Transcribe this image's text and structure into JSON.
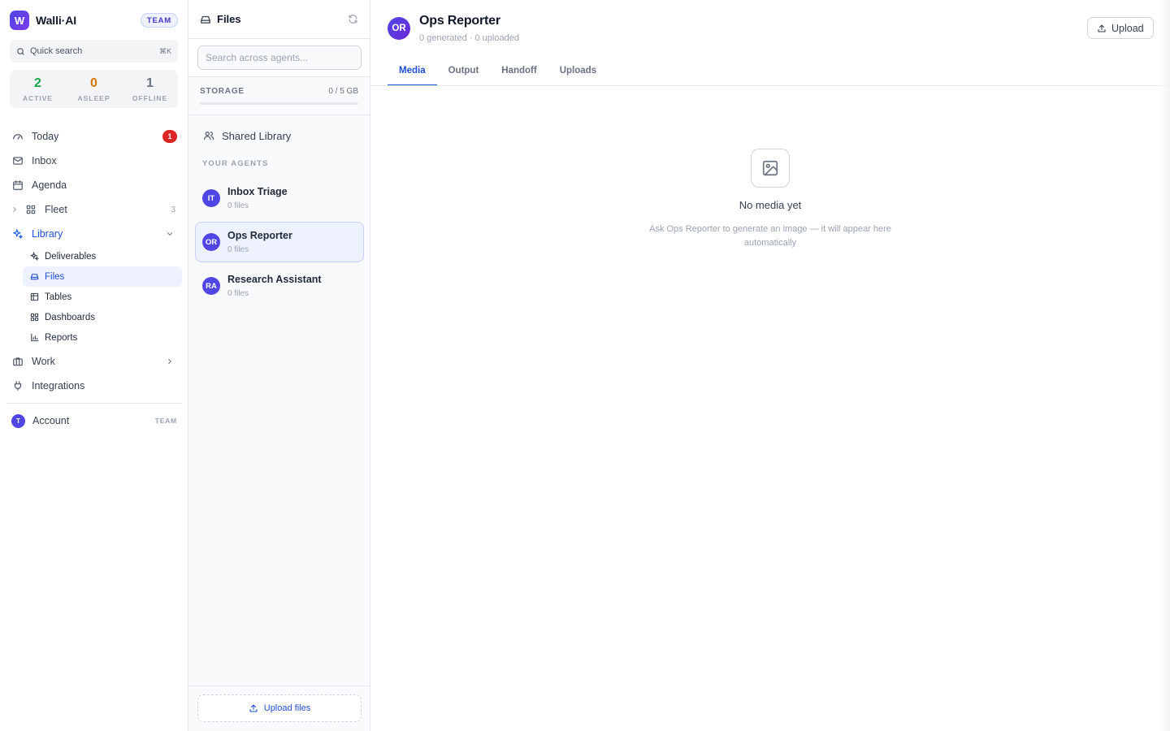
{
  "brand": {
    "logo_letter": "W",
    "name": "Walli·AI",
    "badge": "TEAM"
  },
  "quick_search": {
    "label": "Quick search",
    "shortcut": "⌘K"
  },
  "stats": [
    {
      "value": "2",
      "label": "ACTIVE",
      "color": "#16a34a"
    },
    {
      "value": "0",
      "label": "ASLEEP",
      "color": "#d97706"
    },
    {
      "value": "1",
      "label": "OFFLINE",
      "color": "#6b7280"
    }
  ],
  "nav": {
    "today": {
      "label": "Today",
      "badge": "1"
    },
    "inbox": {
      "label": "Inbox"
    },
    "agenda": {
      "label": "Agenda"
    },
    "fleet": {
      "label": "Fleet",
      "count": "3"
    },
    "library": {
      "label": "Library"
    },
    "library_items": [
      {
        "label": "Deliverables",
        "icon": "sparkles-icon"
      },
      {
        "label": "Files",
        "icon": "drive-icon"
      },
      {
        "label": "Tables",
        "icon": "table-icon"
      },
      {
        "label": "Dashboards",
        "icon": "grid-icon"
      },
      {
        "label": "Reports",
        "icon": "bar-chart-icon"
      }
    ],
    "work": {
      "label": "Work"
    },
    "integrations": {
      "label": "Integrations"
    },
    "account": {
      "avatar": "T",
      "label": "Account",
      "badge": "TEAM"
    }
  },
  "files_panel": {
    "title": "Files",
    "search_placeholder": "Search across agents...",
    "storage": {
      "label": "STORAGE",
      "value": "0 / 5 GB",
      "used_fraction": 0
    },
    "shared_library": "Shared Library",
    "section_label": "YOUR AGENTS",
    "agents": [
      {
        "initials": "IT",
        "name": "Inbox Triage",
        "files": "0 files"
      },
      {
        "initials": "OR",
        "name": "Ops Reporter",
        "files": "0 files"
      },
      {
        "initials": "RA",
        "name": "Research Assistant",
        "files": "0 files"
      }
    ],
    "upload_label": "Upload files"
  },
  "main": {
    "avatar": "OR",
    "title": "Ops Reporter",
    "subtitle": "0 generated · 0 uploaded",
    "upload_label": "Upload",
    "tabs": [
      "Media",
      "Output",
      "Handoff",
      "Uploads"
    ],
    "empty": {
      "title": "No media yet",
      "description": "Ask Ops Reporter to generate an image — it will appear here automatically"
    }
  },
  "colors": {
    "accent": "#1d4ed8",
    "brand": "#4f46e5",
    "alert": "#dc2626"
  }
}
